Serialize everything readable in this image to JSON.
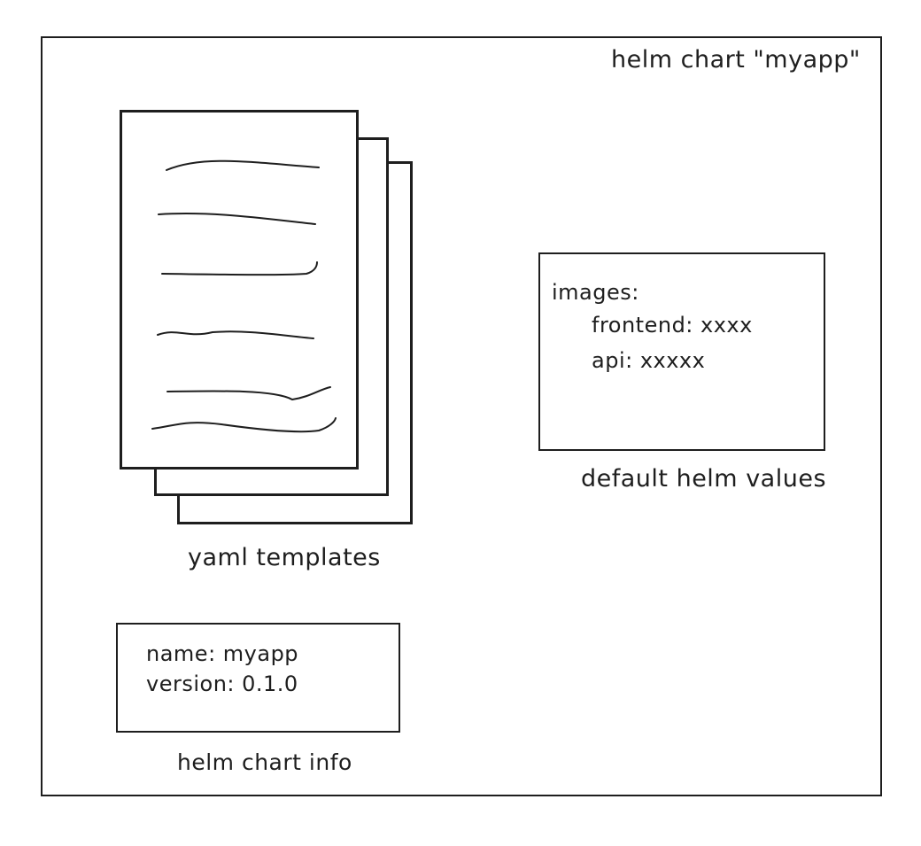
{
  "diagram": {
    "title": "helm chart \"myapp\"",
    "templates": {
      "label": "yaml templates"
    },
    "values": {
      "lines": [
        "images:",
        "frontend: xxxx",
        "api: xxxxx"
      ],
      "label": "default helm values"
    },
    "info": {
      "lines": [
        "name: myapp",
        "version: 0.1.0"
      ],
      "label": "helm chart info"
    }
  }
}
